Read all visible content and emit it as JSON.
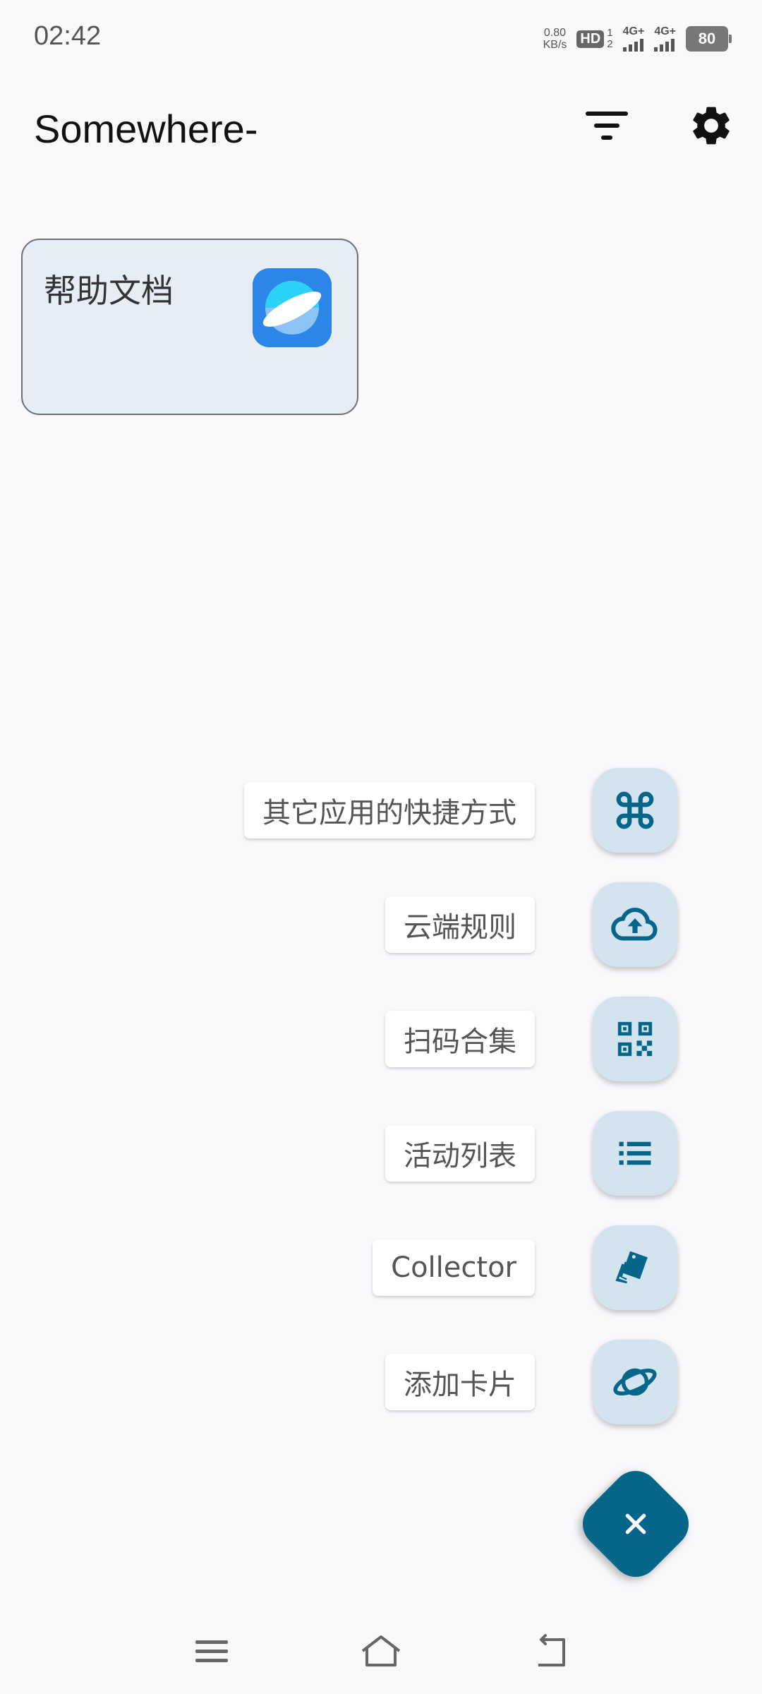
{
  "status_bar": {
    "time": "02:42",
    "net_speed_value": "0.80",
    "net_speed_unit": "KB/s",
    "hd_badge": "HD",
    "hd_sim_1": "1",
    "hd_sim_2": "2",
    "signal_1_label": "4G+",
    "signal_2_label": "4G+",
    "battery": "80"
  },
  "app_bar": {
    "title": "Somewhere-",
    "filter_icon": "filter-icon",
    "settings_icon": "gear-icon"
  },
  "cards": [
    {
      "title": "帮助文档",
      "icon": "planet-app-icon",
      "icon_color": "#2b86e8"
    }
  ],
  "speed_dial": {
    "items": [
      {
        "label": "其它应用的快捷方式",
        "icon": "command-icon"
      },
      {
        "label": "云端规则",
        "icon": "cloud-upload-icon"
      },
      {
        "label": "扫码合集",
        "icon": "qr-code-icon"
      },
      {
        "label": "活动列表",
        "icon": "list-icon"
      },
      {
        "label": "Collector",
        "icon": "cards-icon"
      },
      {
        "label": "添加卡片",
        "icon": "planet-icon"
      }
    ],
    "close_icon": "close-icon"
  },
  "nav_bar": {
    "menu_icon": "menu-icon",
    "home_icon": "home-icon",
    "back_icon": "back-icon"
  },
  "colors": {
    "accent": "#05668a",
    "dial_button_bg": "#d3e4ef",
    "card_bg": "#e6edf5",
    "background": "#f9f9fc"
  }
}
